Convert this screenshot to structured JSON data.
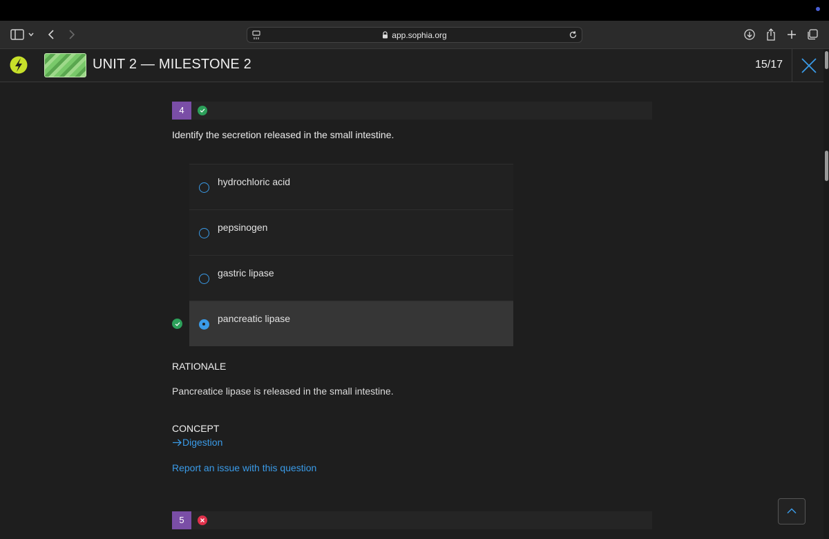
{
  "browser": {
    "url": "app.sophia.org"
  },
  "header": {
    "unit_title": "UNIT 2 — MILESTONE 2",
    "progress": "15/17"
  },
  "question4": {
    "number": "4",
    "status": "correct",
    "prompt": "Identify the secretion released in the small intestine.",
    "options": [
      {
        "label": "hydrochloric acid",
        "selected": false
      },
      {
        "label": "pepsinogen",
        "selected": false
      },
      {
        "label": "gastric lipase",
        "selected": false
      },
      {
        "label": "pancreatic lipase",
        "selected": true,
        "correct": true
      }
    ],
    "rationale_heading": "RATIONALE",
    "rationale_text": "Pancreatice lipase is released in the small intestine.",
    "concept_heading": "CONCEPT",
    "concept_link": "Digestion",
    "report_link": "Report an issue with this question"
  },
  "question5": {
    "number": "5",
    "status": "incorrect"
  },
  "colors": {
    "accent": "#3a9be8",
    "correct": "#2ca05a",
    "incorrect": "#e0314b",
    "badge": "#7a4ea6",
    "logo": "#c7e02a"
  }
}
